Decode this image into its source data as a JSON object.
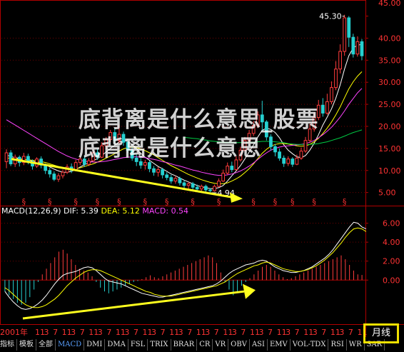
{
  "chart_data": {
    "type": "candlestick",
    "price_axis": {
      "ticks": [
        5,
        10,
        15,
        20,
        25,
        30,
        35,
        40,
        45
      ],
      "labels": [
        "5.00",
        "10.00",
        "15.00",
        "20.00",
        "25.00",
        "30.00",
        "35.00",
        "40.00",
        "45.00"
      ],
      "ylim": [
        3,
        48
      ]
    },
    "price_annotations": {
      "high": "45.30",
      "low": "4.94"
    },
    "candles": [
      [
        12.0,
        14.0,
        10.5,
        14.8
      ],
      [
        14.0,
        11.5,
        11.0,
        14.6
      ],
      [
        11.5,
        13.0,
        10.8,
        13.6
      ],
      [
        13.0,
        11.8,
        10.9,
        13.4
      ],
      [
        11.8,
        13.2,
        11.2,
        14.0
      ],
      [
        13.2,
        12.0,
        11.4,
        13.8
      ],
      [
        12.0,
        11.0,
        10.2,
        12.5
      ],
      [
        11.0,
        12.6,
        10.6,
        13.0
      ],
      [
        12.6,
        11.2,
        10.5,
        13.2
      ],
      [
        11.2,
        10.0,
        9.2,
        11.6
      ],
      [
        10.0,
        9.2,
        8.4,
        10.6
      ],
      [
        9.2,
        8.0,
        7.6,
        9.8
      ],
      [
        8.0,
        8.8,
        7.4,
        9.4
      ],
      [
        8.8,
        9.6,
        8.2,
        10.2
      ],
      [
        9.6,
        10.8,
        9.2,
        11.4
      ],
      [
        10.8,
        10.0,
        9.4,
        11.6
      ],
      [
        10.0,
        11.8,
        9.8,
        12.4
      ],
      [
        11.8,
        12.6,
        11.2,
        13.2
      ],
      [
        12.6,
        11.4,
        10.8,
        13.4
      ],
      [
        11.4,
        12.2,
        11.0,
        12.8
      ],
      [
        12.2,
        14.0,
        12.0,
        14.6
      ],
      [
        14.0,
        13.0,
        12.4,
        15.0
      ],
      [
        13.0,
        15.6,
        12.8,
        16.4
      ],
      [
        15.6,
        17.0,
        14.8,
        17.6
      ],
      [
        17.0,
        18.6,
        16.4,
        19.2
      ],
      [
        18.6,
        16.8,
        16.0,
        19.6
      ],
      [
        16.8,
        18.2,
        16.2,
        20.4
      ],
      [
        18.2,
        16.4,
        15.6,
        18.8
      ],
      [
        16.4,
        14.6,
        14.0,
        17.2
      ],
      [
        14.6,
        12.8,
        12.2,
        15.2
      ],
      [
        12.8,
        12.0,
        11.0,
        13.6
      ],
      [
        12.0,
        11.2,
        10.4,
        12.8
      ],
      [
        11.2,
        11.8,
        10.2,
        12.4
      ],
      [
        11.8,
        10.4,
        9.6,
        12.2
      ],
      [
        10.4,
        9.6,
        8.8,
        11.0
      ],
      [
        9.6,
        10.2,
        8.6,
        10.8
      ],
      [
        10.2,
        9.0,
        8.2,
        10.6
      ],
      [
        9.0,
        8.4,
        7.8,
        9.6
      ],
      [
        8.4,
        7.6,
        7.0,
        9.0
      ],
      [
        7.6,
        8.2,
        7.0,
        8.8
      ],
      [
        8.2,
        7.2,
        6.6,
        8.6
      ],
      [
        7.2,
        6.6,
        6.0,
        7.8
      ],
      [
        6.6,
        7.0,
        5.8,
        7.4
      ],
      [
        7.0,
        6.2,
        5.6,
        7.4
      ],
      [
        6.2,
        5.8,
        5.2,
        6.8
      ],
      [
        5.8,
        6.4,
        5.4,
        6.8
      ],
      [
        6.4,
        5.6,
        5.0,
        6.8
      ],
      [
        5.6,
        5.4,
        4.94,
        6.0
      ],
      [
        5.4,
        6.4,
        5.2,
        6.8
      ],
      [
        6.4,
        7.6,
        6.2,
        8.2
      ],
      [
        7.6,
        9.4,
        7.4,
        10.2
      ],
      [
        9.4,
        11.0,
        9.0,
        11.8
      ],
      [
        11.0,
        10.2,
        9.6,
        12.0
      ],
      [
        10.2,
        12.4,
        10.0,
        13.2
      ],
      [
        12.4,
        14.6,
        12.0,
        15.4
      ],
      [
        14.6,
        16.8,
        14.2,
        17.6
      ],
      [
        16.8,
        18.4,
        16.2,
        19.2
      ],
      [
        18.4,
        20.2,
        17.8,
        21.2
      ],
      [
        20.2,
        22.6,
        19.6,
        23.4
      ],
      [
        22.6,
        21.0,
        19.0,
        25.8
      ],
      [
        21.0,
        17.6,
        16.8,
        21.4
      ],
      [
        17.6,
        15.4,
        14.6,
        18.2
      ],
      [
        15.4,
        14.2,
        13.2,
        16.0
      ],
      [
        14.2,
        12.8,
        12.2,
        15.0
      ],
      [
        12.8,
        11.6,
        10.8,
        13.4
      ],
      [
        11.6,
        12.6,
        11.0,
        13.2
      ],
      [
        12.6,
        11.4,
        10.8,
        13.0
      ],
      [
        11.4,
        12.8,
        11.2,
        13.6
      ],
      [
        12.8,
        14.4,
        12.4,
        15.2
      ],
      [
        14.4,
        16.8,
        14.0,
        17.6
      ],
      [
        16.8,
        19.4,
        16.2,
        20.6
      ],
      [
        19.4,
        22.0,
        18.8,
        23.2
      ],
      [
        22.0,
        24.8,
        21.4,
        26.0
      ],
      [
        24.8,
        23.0,
        22.2,
        26.4
      ],
      [
        23.0,
        25.6,
        22.6,
        27.4
      ],
      [
        25.6,
        28.8,
        25.0,
        30.2
      ],
      [
        28.8,
        33.0,
        28.2,
        34.8
      ],
      [
        33.0,
        37.0,
        32.0,
        38.6
      ],
      [
        37.0,
        44.6,
        36.0,
        45.3
      ],
      [
        44.6,
        40.2,
        38.0,
        45.0
      ],
      [
        40.2,
        36.4,
        35.6,
        41.0
      ],
      [
        36.4,
        39.2,
        35.8,
        40.4
      ],
      [
        39.2,
        36.0,
        35.0,
        39.8
      ]
    ],
    "ma_series": [
      {
        "color": "#ffffff",
        "values": [
          13.5,
          13.2,
          12.9,
          12.7,
          12.5,
          12.4,
          12.1,
          11.9,
          11.7,
          11.3,
          10.8,
          10.3,
          9.9,
          9.6,
          9.6,
          9.8,
          10.2,
          10.8,
          11.3,
          11.7,
          12.2,
          12.7,
          13.4,
          14.2,
          15.0,
          15.7,
          16.5,
          16.8,
          16.6,
          15.9,
          15.0,
          13.9,
          13.0,
          12.3,
          11.6,
          10.9,
          10.4,
          9.8,
          9.2,
          8.8,
          8.3,
          7.8,
          7.4,
          7.0,
          6.6,
          6.3,
          6.1,
          5.9,
          5.9,
          6.1,
          6.6,
          7.6,
          8.8,
          9.9,
          11.1,
          12.6,
          14.2,
          15.8,
          17.6,
          19.1,
          19.6,
          19.3,
          18.6,
          17.4,
          15.8,
          14.6,
          13.8,
          13.1,
          12.9,
          13.4,
          14.6,
          16.2,
          18.1,
          20.3,
          22.1,
          24.0,
          26.4,
          29.4,
          33.0,
          36.0,
          37.8,
          38.4,
          38.6
        ]
      },
      {
        "color": "#ffff00",
        "values": [
          12.8,
          12.8,
          12.7,
          12.6,
          12.5,
          12.4,
          12.3,
          12.2,
          12.0,
          11.8,
          11.5,
          11.2,
          10.9,
          10.6,
          10.4,
          10.3,
          10.4,
          10.6,
          10.9,
          11.2,
          11.5,
          11.9,
          12.3,
          12.8,
          13.3,
          13.8,
          14.4,
          14.9,
          15.2,
          15.3,
          15.2,
          14.9,
          14.5,
          14.0,
          13.5,
          12.9,
          12.3,
          11.7,
          11.1,
          10.6,
          10.1,
          9.6,
          9.1,
          8.7,
          8.3,
          7.9,
          7.6,
          7.3,
          7.1,
          7.0,
          7.0,
          7.2,
          7.6,
          8.1,
          8.7,
          9.5,
          10.4,
          11.5,
          12.7,
          13.9,
          14.8,
          15.5,
          15.9,
          16.1,
          16.1,
          16.0,
          15.8,
          15.6,
          15.5,
          15.6,
          15.9,
          16.5,
          17.3,
          18.4,
          19.6,
          21.0,
          22.6,
          24.4,
          26.5,
          28.5,
          30.1,
          31.4,
          32.4
        ]
      },
      {
        "color": "#ff44ff",
        "values": [
          21.5,
          20.9,
          20.3,
          19.7,
          19.1,
          18.5,
          17.9,
          17.3,
          16.7,
          16.1,
          15.5,
          14.9,
          14.3,
          13.8,
          13.3,
          12.9,
          12.6,
          12.3,
          12.1,
          12.0,
          11.9,
          11.9,
          12.0,
          12.1,
          12.3,
          12.5,
          12.7,
          12.9,
          13.0,
          13.1,
          13.1,
          13.0,
          12.9,
          12.7,
          12.5,
          12.3,
          12.0,
          11.8,
          11.5,
          11.2,
          11.0,
          10.7,
          10.4,
          10.1,
          9.9,
          9.6,
          9.4,
          9.2,
          9.0,
          8.9,
          8.9,
          9.0,
          9.2,
          9.5,
          9.9,
          10.4,
          11.0,
          11.7,
          12.5,
          13.3,
          14.0,
          14.6,
          15.0,
          15.3,
          15.5,
          15.6,
          15.7,
          15.8,
          15.9,
          16.1,
          16.4,
          16.8,
          17.4,
          18.1,
          18.9,
          19.8,
          20.9,
          22.1,
          23.5,
          25.0,
          26.3,
          27.6,
          28.6
        ]
      },
      {
        "color": "#00cc44",
        "values": [
          null,
          null,
          null,
          null,
          null,
          null,
          null,
          null,
          null,
          null,
          null,
          null,
          null,
          null,
          null,
          null,
          null,
          null,
          null,
          null,
          null,
          null,
          null,
          null,
          null,
          null,
          null,
          null,
          null,
          null,
          null,
          null,
          null,
          null,
          null,
          null,
          null,
          null,
          null,
          null,
          null,
          17.5,
          17.4,
          17.3,
          17.2,
          17.0,
          16.9,
          16.7,
          16.6,
          16.5,
          16.4,
          16.3,
          16.3,
          16.3,
          16.3,
          16.3,
          16.4,
          16.4,
          16.5,
          16.6,
          16.6,
          16.6,
          16.5,
          16.4,
          16.3,
          16.1,
          16.0,
          15.9,
          15.9,
          15.9,
          15.9,
          16.0,
          16.1,
          16.3,
          16.5,
          16.8,
          17.1,
          17.4,
          17.8,
          18.2,
          18.6,
          18.9,
          19.2
        ]
      }
    ],
    "price_markers": {
      "symbol": "§",
      "at": [
        4,
        10,
        16,
        21,
        26,
        32,
        37,
        43,
        49,
        57,
        62,
        66,
        71,
        78
      ]
    },
    "macd": {
      "title": "MACD(12,26,9)",
      "dif_label": "DIF: 5.39",
      "dea_label": "DEA: 5.12",
      "macd_label": "MACD: 0.54",
      "axis": {
        "ticks": [
          0,
          2,
          4,
          6
        ],
        "labels": [
          "0.00",
          "2.00",
          "4.00",
          "6.00"
        ],
        "ylim": [
          -4.2,
          6.8
        ]
      },
      "dif": [
        -1.2,
        -1.8,
        -2.3,
        -2.7,
        -3.0,
        -3.1,
        -3.0,
        -2.8,
        -2.5,
        -2.1,
        -1.6,
        -1.0,
        -0.4,
        0.1,
        0.5,
        0.7,
        0.8,
        0.9,
        1.1,
        1.3,
        1.4,
        1.3,
        1.0,
        0.6,
        0.2,
        -0.1,
        -0.2,
        -0.3,
        -0.4,
        -0.6,
        -0.8,
        -1.0,
        -1.2,
        -1.4,
        -1.5,
        -1.6,
        -1.7,
        -1.8,
        -1.8,
        -1.7,
        -1.6,
        -1.5,
        -1.4,
        -1.3,
        -1.2,
        -1.1,
        -1.0,
        -0.9,
        -0.8,
        -0.7,
        -0.6,
        -0.4,
        -0.1,
        0.3,
        0.7,
        1.0,
        1.2,
        1.4,
        1.6,
        1.7,
        1.8,
        2.0,
        2.1,
        2.0,
        1.7,
        1.4,
        1.2,
        1.0,
        0.9,
        0.8,
        0.8,
        0.9,
        1.0,
        1.2,
        1.4,
        1.7,
        2.0,
        2.3,
        2.7,
        3.2,
        3.8,
        4.4,
        5.0,
        5.6,
        6.1,
        6.0,
        5.6,
        5.4
      ],
      "dea": [
        -0.8,
        -1.1,
        -1.5,
        -1.9,
        -2.3,
        -2.6,
        -2.8,
        -2.9,
        -2.9,
        -2.8,
        -2.6,
        -2.3,
        -2.0,
        -1.6,
        -1.1,
        -0.6,
        -0.2,
        0.2,
        0.5,
        0.8,
        1.0,
        1.1,
        1.1,
        1.0,
        0.8,
        0.6,
        0.4,
        0.2,
        0.0,
        -0.2,
        -0.4,
        -0.6,
        -0.8,
        -1.0,
        -1.2,
        -1.3,
        -1.5,
        -1.6,
        -1.7,
        -1.7,
        -1.7,
        -1.6,
        -1.5,
        -1.4,
        -1.3,
        -1.2,
        -1.1,
        -1.0,
        -0.9,
        -0.8,
        -0.7,
        -0.6,
        -0.4,
        -0.2,
        0.1,
        0.4,
        0.7,
        0.9,
        1.1,
        1.3,
        1.5,
        1.6,
        1.8,
        1.9,
        1.8,
        1.6,
        1.4,
        1.2,
        1.1,
        1.0,
        0.9,
        0.9,
        1.0,
        1.1,
        1.3,
        1.5,
        1.8,
        2.1,
        2.5,
        2.9,
        3.4,
        3.9,
        4.5,
        5.0,
        5.4,
        5.5,
        5.4,
        5.12
      ],
      "hist": [
        -1.2,
        -1.6,
        -2.0,
        -2.4,
        -2.6,
        -2.4,
        -1.8,
        -1.0,
        -0.2,
        0.6,
        1.2,
        1.8,
        2.4,
        3.0,
        3.2,
        2.8,
        2.2,
        1.6,
        1.2,
        1.0,
        0.8,
        0.4,
        -0.2,
        -0.8,
        -1.2,
        -1.4,
        -1.2,
        -1.0,
        -0.8,
        -0.6,
        -0.4,
        -0.2,
        -0.1,
        0.1,
        0.3,
        0.5,
        0.3,
        0.2,
        0.4,
        0.6,
        0.8,
        1.0,
        1.2,
        1.4,
        1.6,
        1.8,
        2.0,
        2.2,
        2.4,
        2.6,
        2.4,
        1.8,
        0.8,
        -0.2,
        -1.0,
        -1.6,
        -1.2,
        -0.6,
        -0.2,
        0.2,
        0.6,
        1.0,
        1.4,
        1.6,
        1.4,
        1.0,
        0.6,
        0.3,
        0.1,
        0.2,
        0.4,
        0.6,
        0.8,
        1.0,
        1.2,
        1.4,
        1.6,
        1.8,
        2.0,
        2.2,
        2.4,
        2.6,
        2.2,
        1.6,
        1.0,
        0.6,
        0.54
      ]
    },
    "x_axis": {
      "labels": [
        "2001年",
        "11",
        "3",
        "7",
        "11",
        "3",
        "7",
        "11",
        "3",
        "7",
        "11",
        "3",
        "7",
        "11",
        "3",
        "7",
        "11",
        "3",
        "7",
        "11",
        "3",
        "7",
        "11",
        "3",
        "7",
        "11",
        "3",
        "7",
        "11",
        "3",
        "7",
        "11",
        "3",
        "7",
        "11",
        "3",
        "7",
        "11"
      ]
    }
  },
  "watermark": "底背离是什么意思_股票底背离是什么意思",
  "tabs": [
    "指标",
    "模板",
    "全部",
    "MACD",
    "DMI",
    "DMA",
    "FSL",
    "TRIX",
    "BRAR",
    "CR",
    "VR",
    "OBV",
    "ASI",
    "EMV",
    "VOL-TDX",
    "RSI",
    "WR",
    "SAR"
  ],
  "active_tab": "MACD",
  "period_button": "月线",
  "colors": {
    "up": "#ff3c3c",
    "down": "#26d0d0",
    "axis": "#b00000",
    "arrow": "#ffff1e",
    "label_red": "#ff3333",
    "dif": "#ffffff",
    "dea": "#ffff00",
    "macd_text": "#ff44ff",
    "annotation": "#ffffff"
  }
}
